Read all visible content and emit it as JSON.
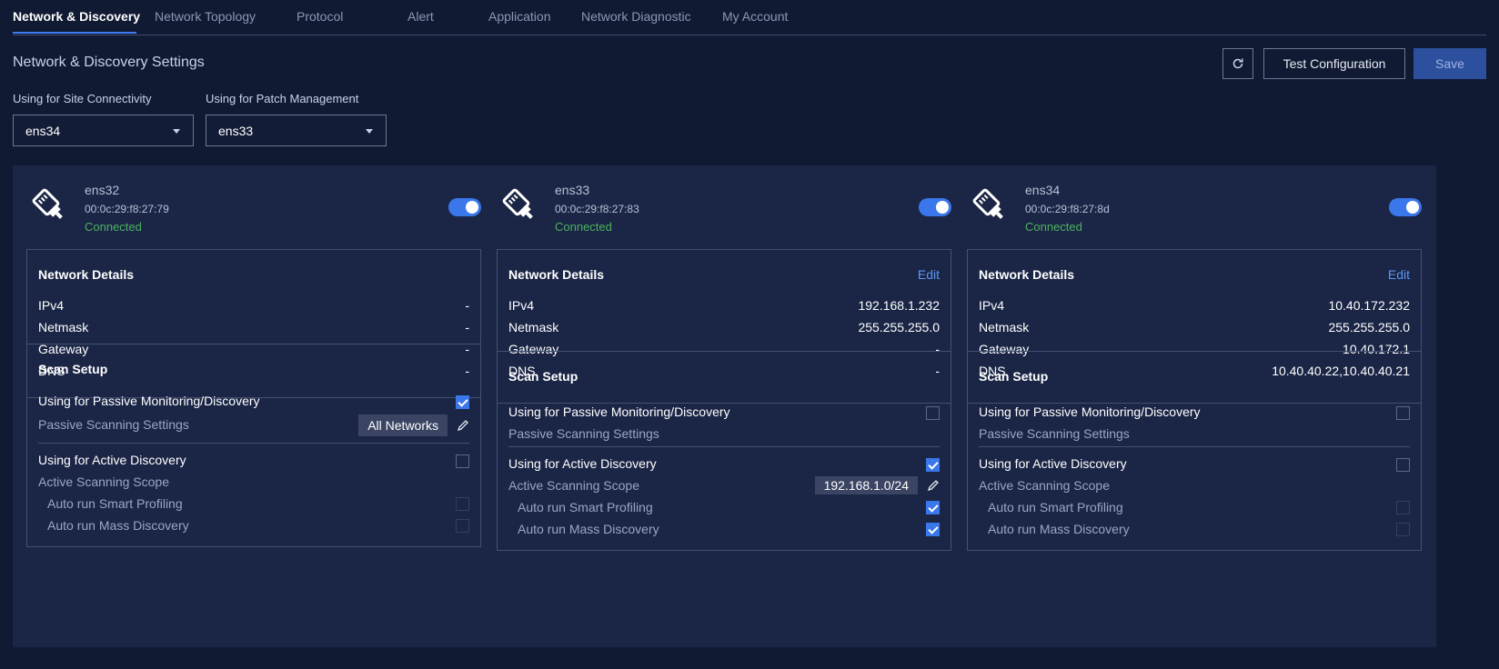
{
  "tabs": [
    {
      "label": "Network & Discovery",
      "active": true
    },
    {
      "label": "Network Topology"
    },
    {
      "label": "Protocol"
    },
    {
      "label": "Alert"
    },
    {
      "label": "Application"
    },
    {
      "label": "Network Diagnostic"
    },
    {
      "label": "My Account"
    }
  ],
  "page_title": "Network & Discovery Settings",
  "toolbar": {
    "refresh_icon": "refresh-icon",
    "test_label": "Test Configuration",
    "save_label": "Save"
  },
  "site_connectivity": {
    "label": "Using for Site Connectivity",
    "value": "ens34"
  },
  "patch_management": {
    "label": "Using for Patch Management",
    "value": "ens33"
  },
  "colors": {
    "accent": "#3a77ea",
    "connected": "#4cb25e",
    "link": "#5d94f5",
    "background": "#111a33",
    "card": "#1b2646"
  },
  "cards": [
    {
      "name": "ens32",
      "mac": "00:0c:29:f8:27:79",
      "status": "Connected",
      "enabled": true,
      "icon": "ethernet-icon",
      "details_title": "Network Details",
      "edit_label": "",
      "ipv4_label": "IPv4",
      "ipv4": "-",
      "netmask_label": "Netmask",
      "netmask": "-",
      "gateway_label": "Gateway",
      "gateway": "-",
      "dns_label": "DNS",
      "dns": "-",
      "scan_title": "Scan Setup",
      "passive_label": "Using for Passive Monitoring/Discovery",
      "passive_checked": true,
      "passive_settings_label": "Passive Scanning Settings",
      "passive_scope": "All Networks",
      "active_label": "Using for Active Discovery",
      "active_checked": false,
      "active_scope_label": "Active Scanning Scope",
      "active_scope": "",
      "smart_label": "Auto run Smart Profiling",
      "smart_checked": false,
      "mass_label": "Auto run Mass Discovery",
      "mass_checked": false
    },
    {
      "name": "ens33",
      "mac": "00:0c:29:f8:27:83",
      "status": "Connected",
      "enabled": true,
      "icon": "ethernet-icon",
      "details_title": "Network Details",
      "edit_label": "Edit",
      "ipv4_label": "IPv4",
      "ipv4": "192.168.1.232",
      "netmask_label": "Netmask",
      "netmask": "255.255.255.0",
      "gateway_label": "Gateway",
      "gateway": "-",
      "dns_label": "DNS",
      "dns": "-",
      "scan_title": "Scan Setup",
      "passive_label": "Using for Passive Monitoring/Discovery",
      "passive_checked": false,
      "passive_settings_label": "Passive Scanning Settings",
      "passive_scope": "",
      "active_label": "Using for Active Discovery",
      "active_checked": true,
      "active_scope_label": "Active Scanning Scope",
      "active_scope": "192.168.1.0/24",
      "smart_label": "Auto run Smart Profiling",
      "smart_checked": true,
      "mass_label": "Auto run Mass Discovery",
      "mass_checked": true
    },
    {
      "name": "ens34",
      "mac": "00:0c:29:f8:27:8d",
      "status": "Connected",
      "enabled": true,
      "icon": "ethernet-icon",
      "details_title": "Network Details",
      "edit_label": "Edit",
      "ipv4_label": "IPv4",
      "ipv4": "10.40.172.232",
      "netmask_label": "Netmask",
      "netmask": "255.255.255.0",
      "gateway_label": "Gateway",
      "gateway": "10.40.172.1",
      "dns_label": "DNS",
      "dns": "10.40.40.22,10.40.40.21",
      "scan_title": "Scan Setup",
      "passive_label": "Using for Passive Monitoring/Discovery",
      "passive_checked": false,
      "passive_settings_label": "Passive Scanning Settings",
      "passive_scope": "",
      "active_label": "Using for Active Discovery",
      "active_checked": false,
      "active_scope_label": "Active Scanning Scope",
      "active_scope": "",
      "smart_label": "Auto run Smart Profiling",
      "smart_checked": false,
      "mass_label": "Auto run Mass Discovery",
      "mass_checked": false
    }
  ]
}
